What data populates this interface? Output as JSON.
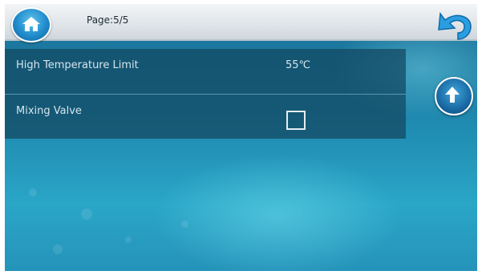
{
  "header": {
    "page_label": "Page:5/5",
    "home_icon": "home-icon",
    "back_icon": "back-arrow-icon"
  },
  "settings": {
    "rows": [
      {
        "label": "High Temperature Limit",
        "value": "55℃"
      },
      {
        "label": "Mixing Valve",
        "checked": false
      }
    ]
  },
  "scroll": {
    "up_icon": "arrow-up-icon"
  },
  "colors": {
    "accent": "#218ccc",
    "panel": "#124660",
    "background": "#1e86ad"
  }
}
